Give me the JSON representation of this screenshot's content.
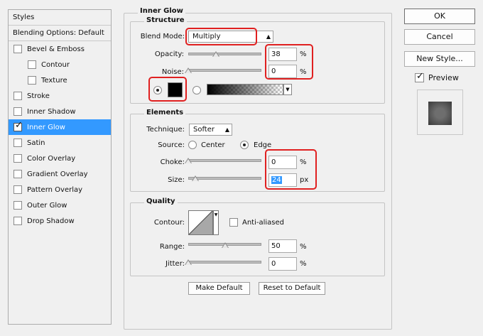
{
  "styles_list": {
    "header": "Styles",
    "blending_options": "Blending Options: Default",
    "items": [
      {
        "label": "Bevel & Emboss",
        "checked": false,
        "sub": false,
        "selected": false
      },
      {
        "label": "Contour",
        "checked": false,
        "sub": true,
        "selected": false
      },
      {
        "label": "Texture",
        "checked": false,
        "sub": true,
        "selected": false
      },
      {
        "label": "Stroke",
        "checked": false,
        "sub": false,
        "selected": false
      },
      {
        "label": "Inner Shadow",
        "checked": false,
        "sub": false,
        "selected": false
      },
      {
        "label": "Inner Glow",
        "checked": true,
        "sub": false,
        "selected": true
      },
      {
        "label": "Satin",
        "checked": false,
        "sub": false,
        "selected": false
      },
      {
        "label": "Color Overlay",
        "checked": false,
        "sub": false,
        "selected": false
      },
      {
        "label": "Gradient Overlay",
        "checked": false,
        "sub": false,
        "selected": false
      },
      {
        "label": "Pattern Overlay",
        "checked": false,
        "sub": false,
        "selected": false
      },
      {
        "label": "Outer Glow",
        "checked": false,
        "sub": false,
        "selected": false
      },
      {
        "label": "Drop Shadow",
        "checked": false,
        "sub": false,
        "selected": false
      }
    ]
  },
  "panel": {
    "title": "Inner Glow",
    "structure": {
      "title": "Structure",
      "blend_mode_label": "Blend Mode:",
      "blend_mode_value": "Multiply",
      "opacity_label": "Opacity:",
      "opacity_value": "38",
      "opacity_fraction": 0.38,
      "noise_label": "Noise:",
      "noise_value": "0",
      "noise_fraction": 0,
      "unit": "%",
      "swatch_color": "#000000"
    },
    "elements": {
      "title": "Elements",
      "technique_label": "Technique:",
      "technique_value": "Softer",
      "source_label": "Source:",
      "source_center": "Center",
      "source_edge": "Edge",
      "source_selected": "Edge",
      "choke_label": "Choke:",
      "choke_value": "0",
      "choke_fraction": 0,
      "size_label": "Size:",
      "size_value": "24",
      "size_fraction": 0.1,
      "choke_unit": "%",
      "size_unit": "px"
    },
    "quality": {
      "title": "Quality",
      "contour_label": "Contour:",
      "anti_aliased_label": "Anti-aliased",
      "anti_aliased": false,
      "range_label": "Range:",
      "range_value": "50",
      "range_fraction": 0.5,
      "jitter_label": "Jitter:",
      "jitter_value": "0",
      "jitter_fraction": 0,
      "unit": "%"
    },
    "make_default": "Make Default",
    "reset_default": "Reset to Default"
  },
  "buttons": {
    "ok": "OK",
    "cancel": "Cancel",
    "new_style": "New Style...",
    "preview_label": "Preview",
    "preview_checked": true
  },
  "colors": {
    "selection": "#3399ff",
    "highlight": "#e02020"
  }
}
